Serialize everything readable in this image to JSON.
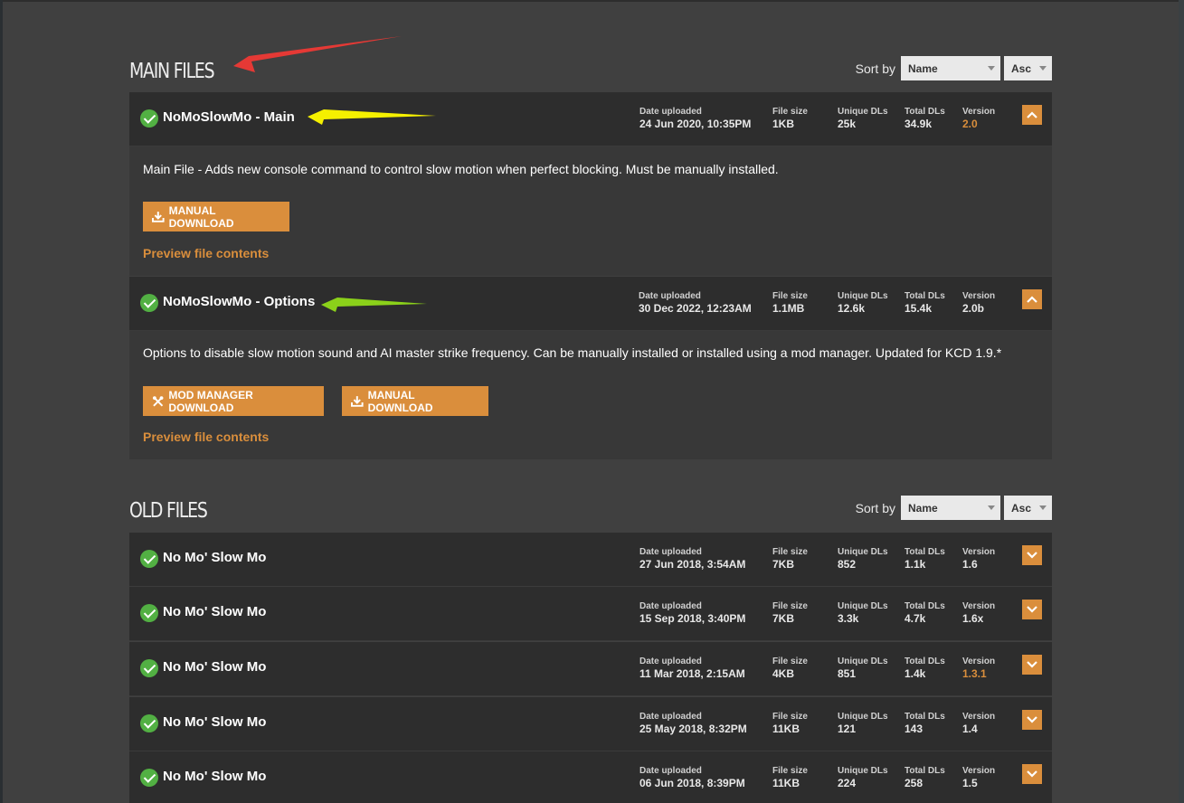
{
  "main_files": {
    "title": "MAIN FILES",
    "sort": {
      "label": "Sort by",
      "field": "Name",
      "direction": "Asc"
    },
    "files": [
      {
        "name": "NoMoSlowMo - Main",
        "stats": {
          "date_label": "Date uploaded",
          "date": "24 Jun 2020, 10:35PM",
          "size_label": "File size",
          "size": "1KB",
          "udl_label": "Unique DLs",
          "udl": "25k",
          "tdl_label": "Total DLs",
          "tdl": "34.9k",
          "ver_label": "Version",
          "ver": "2.0"
        },
        "description": "Main File - Adds new console command to control slow motion when perfect blocking. Must be manually installed.",
        "buttons": [
          "MANUAL DOWNLOAD"
        ],
        "preview": "Preview file contents"
      },
      {
        "name": "NoMoSlowMo - Options",
        "stats": {
          "date_label": "Date uploaded",
          "date": "30 Dec 2022, 12:23AM",
          "size_label": "File size",
          "size": "1.1MB",
          "udl_label": "Unique DLs",
          "udl": "12.6k",
          "tdl_label": "Total DLs",
          "tdl": "15.4k",
          "ver_label": "Version",
          "ver": "2.0b"
        },
        "description": "Options to disable slow motion sound and AI master strike frequency. Can be manually installed or installed using a mod manager. Updated for KCD 1.9.*",
        "buttons": [
          "MOD MANAGER DOWNLOAD",
          "MANUAL DOWNLOAD"
        ],
        "preview": "Preview file contents"
      }
    ]
  },
  "old_files": {
    "title": "OLD FILES",
    "sort": {
      "label": "Sort by",
      "field": "Name",
      "direction": "Asc"
    },
    "files": [
      {
        "name": "No Mo' Slow Mo",
        "date_label": "Date uploaded",
        "date": "27 Jun 2018, 3:54AM",
        "size_label": "File size",
        "size": "7KB",
        "udl_label": "Unique DLs",
        "udl": "852",
        "tdl_label": "Total DLs",
        "tdl": "1.1k",
        "ver_label": "Version",
        "ver": "1.6"
      },
      {
        "name": "No Mo' Slow Mo",
        "date_label": "Date uploaded",
        "date": "15 Sep 2018, 3:40PM",
        "size_label": "File size",
        "size": "7KB",
        "udl_label": "Unique DLs",
        "udl": "3.3k",
        "tdl_label": "Total DLs",
        "tdl": "4.7k",
        "ver_label": "Version",
        "ver": "1.6x"
      },
      {
        "name": "No Mo' Slow Mo",
        "date_label": "Date uploaded",
        "date": "11 Mar 2018, 2:15AM",
        "size_label": "File size",
        "size": "4KB",
        "udl_label": "Unique DLs",
        "udl": "851",
        "tdl_label": "Total DLs",
        "tdl": "1.4k",
        "ver_label": "Version",
        "ver": "1.3.1"
      },
      {
        "name": "No Mo' Slow Mo",
        "date_label": "Date uploaded",
        "date": "25 May 2018, 8:32PM",
        "size_label": "File size",
        "size": "11KB",
        "udl_label": "Unique DLs",
        "udl": "121",
        "tdl_label": "Total DLs",
        "tdl": "143",
        "ver_label": "Version",
        "ver": "1.4"
      },
      {
        "name": "No Mo' Slow Mo",
        "date_label": "Date uploaded",
        "date": "06 Jun 2018, 8:39PM",
        "size_label": "File size",
        "size": "11KB",
        "udl_label": "Unique DLs",
        "udl": "224",
        "tdl_label": "Total DLs",
        "tdl": "258",
        "ver_label": "Version",
        "ver": "1.5"
      }
    ]
  },
  "colors": {
    "accent": "#da8e3c",
    "check": "#52b043",
    "annotation_red": "#e53935",
    "annotation_yellow": "#f5f000",
    "annotation_green": "#8bd11a"
  },
  "icons": {
    "check": "check-circle-icon",
    "toggle_expanded": "chevron-up-icon",
    "toggle_collapsed": "chevron-down-icon",
    "download": "download-icon",
    "mod_manager": "mod-manager-icon"
  }
}
